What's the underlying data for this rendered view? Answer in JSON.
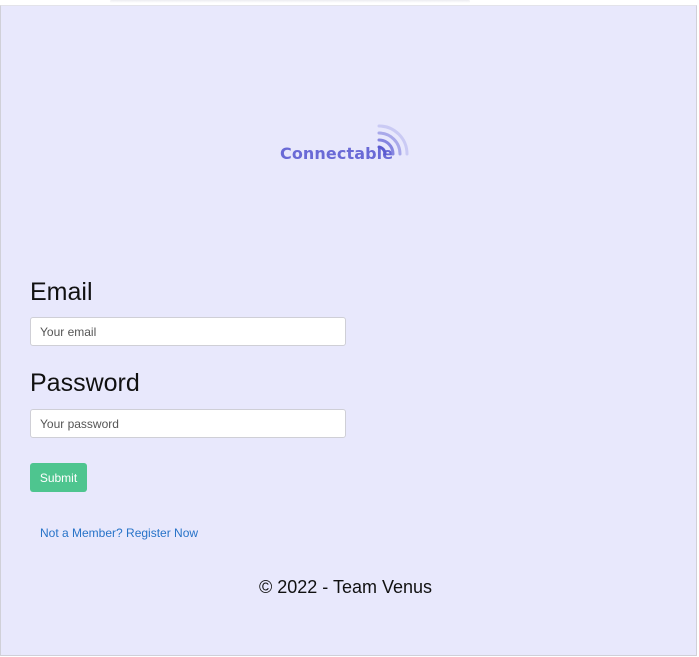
{
  "brand": {
    "name": "Connectable",
    "color": "#6a6ad6",
    "icon": "wifi-signal-icon"
  },
  "form": {
    "email_label": "Email",
    "email_placeholder": "Your email",
    "email_value": "",
    "password_label": "Password",
    "password_placeholder": "Your password",
    "password_value": "",
    "submit_label": "Submit",
    "submit_color": "#4ec58f"
  },
  "register_link": "Not a Member? Register Now",
  "footer": {
    "text": "© 2022 - Team Venus"
  },
  "colors": {
    "background": "#e8e8fc",
    "link": "#2773c8"
  }
}
